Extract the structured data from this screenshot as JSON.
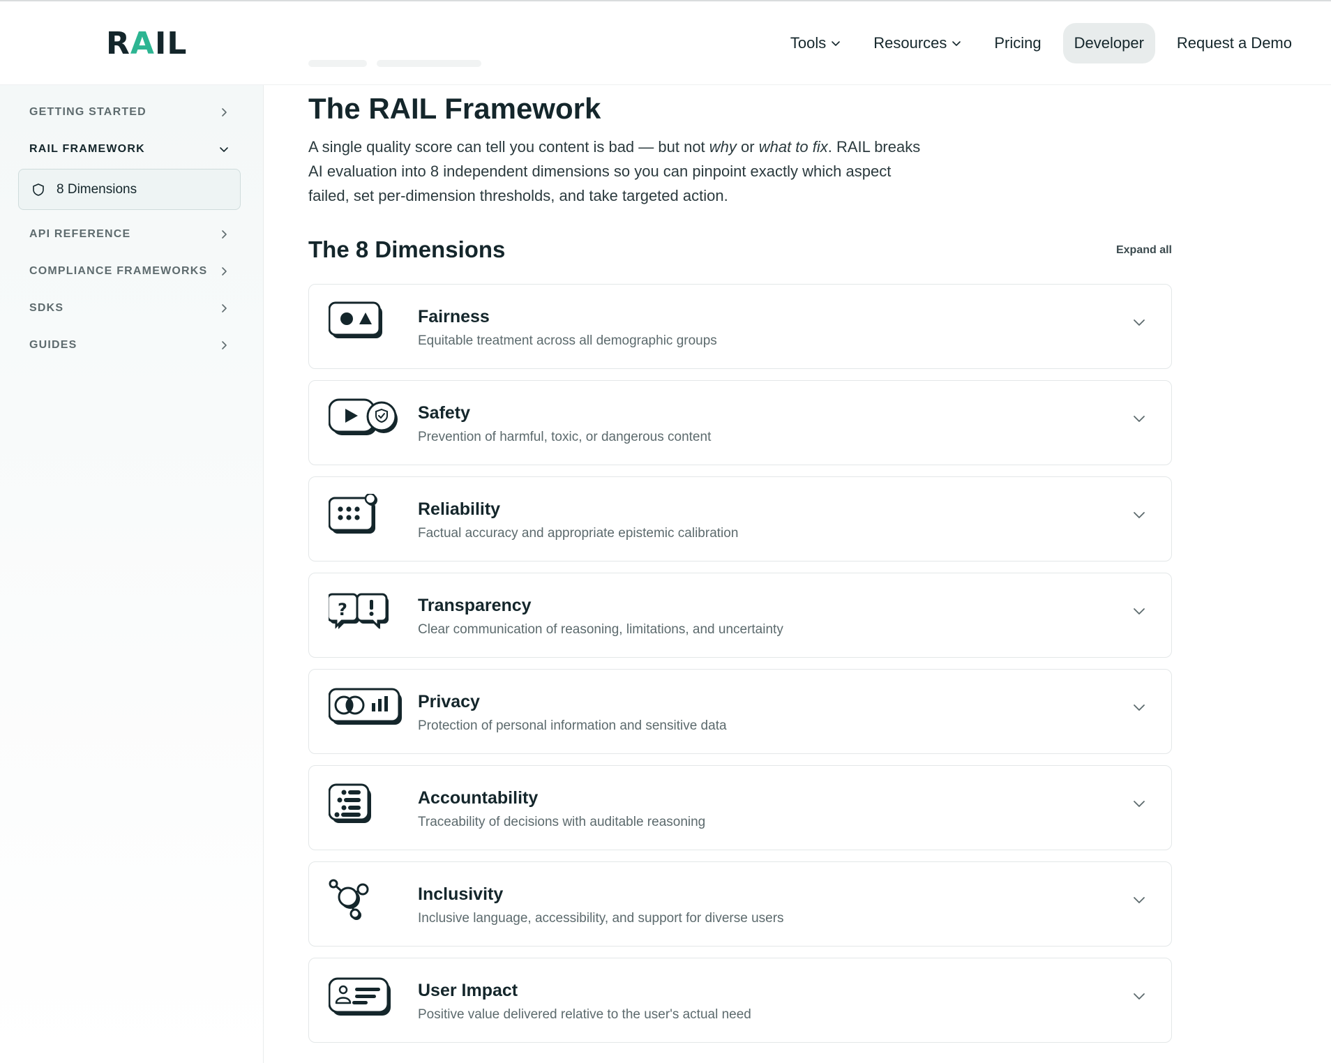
{
  "brand": {
    "logo_prefix": "R",
    "logo_accent": "A",
    "logo_suffix": "IL",
    "accent_color": "#2db592",
    "ink_color": "#14262b"
  },
  "nav": {
    "tools": "Tools",
    "resources": "Resources",
    "pricing": "Pricing",
    "developer": "Developer",
    "demo": "Request a Demo"
  },
  "sidebar": {
    "items": [
      {
        "label": "GETTING STARTED",
        "state": "collapsed"
      },
      {
        "label": "RAIL FRAMEWORK",
        "state": "expanded"
      },
      {
        "label": "API REFERENCE",
        "state": "collapsed"
      },
      {
        "label": "COMPLIANCE FRAMEWORKS",
        "state": "collapsed"
      },
      {
        "label": "SDKS",
        "state": "collapsed"
      },
      {
        "label": "GUIDES",
        "state": "collapsed"
      }
    ],
    "active_sub": {
      "label": "8 Dimensions",
      "icon": "shield-icon"
    }
  },
  "main": {
    "title": "The RAIL Framework",
    "intro": {
      "p1": "A single quality score can tell you content is bad — but not ",
      "em1": "why",
      "p2": " or ",
      "em2": "what to fix",
      "p3": ". RAIL breaks AI evaluation into 8 independent dimensions so you can pinpoint exactly which aspect failed, set per-dimension thresholds, and take targeted action."
    },
    "section_title": "The 8 Dimensions",
    "expand_all": "Expand all",
    "dimensions": [
      {
        "name": "Fairness",
        "desc": "Equitable treatment across all demographic groups",
        "icon": "shapes-icon"
      },
      {
        "name": "Safety",
        "desc": "Prevention of harmful, toxic, or dangerous content",
        "icon": "play-shield-icon"
      },
      {
        "name": "Reliability",
        "desc": "Factual accuracy and appropriate epistemic calibration",
        "icon": "keypad-icon"
      },
      {
        "name": "Transparency",
        "desc": "Clear communication of reasoning, limitations, and uncertainty",
        "icon": "question-exclaim-bubbles-icon"
      },
      {
        "name": "Privacy",
        "desc": "Protection of personal information and sensitive data",
        "icon": "eye-chart-icon"
      },
      {
        "name": "Accountability",
        "desc": "Traceability of decisions with auditable reasoning",
        "icon": "list-icon"
      },
      {
        "name": "Inclusivity",
        "desc": "Inclusive language, accessibility, and support for diverse users",
        "icon": "molecule-icon"
      },
      {
        "name": "User Impact",
        "desc": "Positive value delivered relative to the user's actual need",
        "icon": "user-card-icon"
      }
    ]
  }
}
